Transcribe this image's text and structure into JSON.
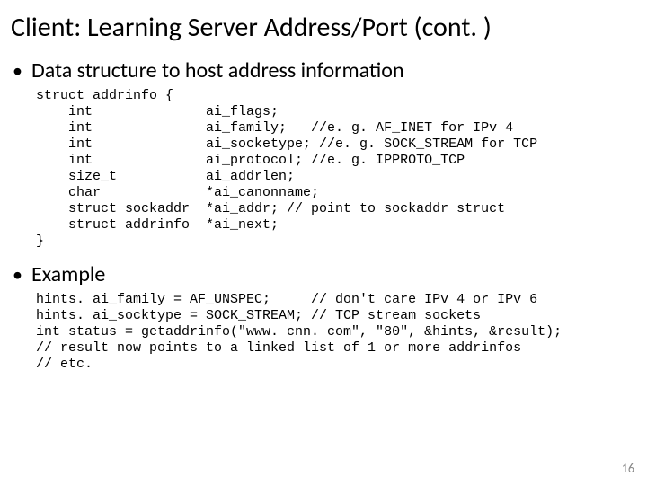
{
  "title": "Client: Learning Server Address/Port (cont. )",
  "bullets": {
    "first": "Data structure to host address information",
    "second": "Example"
  },
  "code": {
    "struct": "struct addrinfo {\n    int              ai_flags;\n    int              ai_family;   //e. g. AF_INET for IPv 4\n    int              ai_socketype; //e. g. SOCK_STREAM for TCP\n    int              ai_protocol; //e. g. IPPROTO_TCP\n    size_t           ai_addrlen;\n    char             *ai_canonname;\n    struct sockaddr  *ai_addr; // point to sockaddr struct\n    struct addrinfo  *ai_next;\n}",
    "example": "hints. ai_family = AF_UNSPEC;     // don't care IPv 4 or IPv 6\nhints. ai_socktype = SOCK_STREAM; // TCP stream sockets\nint status = getaddrinfo(\"www. cnn. com\", \"80\", &hints, &result);\n// result now points to a linked list of 1 or more addrinfos\n// etc."
  },
  "page_number": "16"
}
